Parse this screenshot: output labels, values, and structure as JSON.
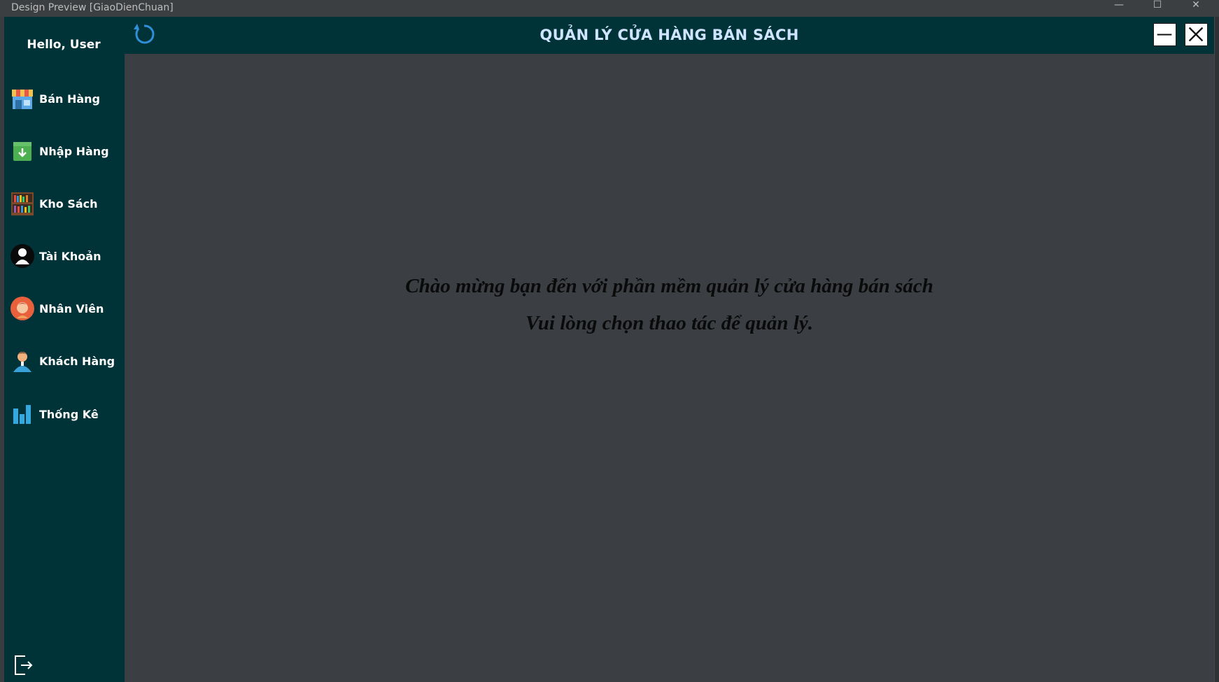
{
  "window": {
    "title": "Design Preview [GiaoDienChuan]",
    "minimize_glyph": "—",
    "maximize_glyph": "☐",
    "close_glyph": "✕"
  },
  "sidebar": {
    "greeting": "Hello, User",
    "items": [
      {
        "label": "Bán Hàng",
        "icon": "store-icon"
      },
      {
        "label": "Nhập Hàng",
        "icon": "import-box-icon"
      },
      {
        "label": "Kho Sách",
        "icon": "bookshelf-icon"
      },
      {
        "label": "Tài Khoản",
        "icon": "account-icon"
      },
      {
        "label": "Nhân Viên",
        "icon": "employee-icon"
      },
      {
        "label": "Khách Hàng",
        "icon": "customer-icon"
      },
      {
        "label": "Thống Kê",
        "icon": "statistics-icon"
      }
    ],
    "logout_icon": "logout-icon"
  },
  "header": {
    "title": "QUẢN LÝ CỬA HÀNG BÁN SÁCH",
    "refresh_icon": "refresh-icon",
    "minimize_icon": "minimize-icon",
    "close_icon": "close-icon"
  },
  "main": {
    "welcome_line1": "Chào mừng bạn đến với phần mềm quản lý cửa hàng bán sách",
    "welcome_line2": "Vui lòng chọn thao tác để quản lý."
  },
  "colors": {
    "sidebar_bg": "#003338",
    "content_bg": "#3b3f43",
    "title_text": "#cfe4ff",
    "refresh_accent": "#2f8fd8"
  }
}
